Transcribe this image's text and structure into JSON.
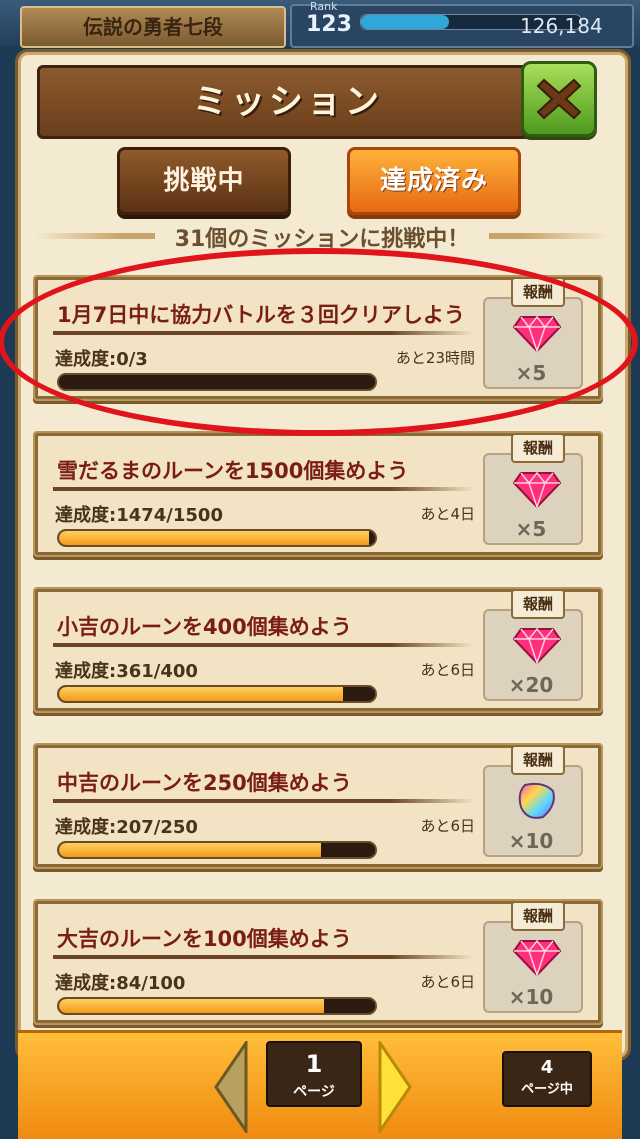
{
  "topbar": {
    "rank_title": "伝説の勇者七段",
    "rank_caption": "Rank",
    "rank_level": "123",
    "rank_points": "126,184",
    "rank_progress": 0.4
  },
  "header": {
    "title": "ミッション",
    "close_icon": "close-x-icon"
  },
  "tabs": [
    {
      "label": "挑戦中",
      "active": true
    },
    {
      "label": "達成済み",
      "active": false
    }
  ],
  "subtitle": "31個のミッションに挑戦中！",
  "reward_label": "報酬",
  "missions": [
    {
      "title": "1月7日中に協力バトルを３回クリアしよう",
      "progress": "達成度:0/3",
      "time": "あと23時間",
      "fraction": 0.0,
      "reward_icon": "gem-icon",
      "reward_count": "×5"
    },
    {
      "title": "雪だるまのルーンを1500個集めよう",
      "progress": "達成度:1474/1500",
      "time": "あと4日",
      "fraction": 0.983,
      "reward_icon": "gem-icon",
      "reward_count": "×5"
    },
    {
      "title": "小吉のルーンを400個集めよう",
      "progress": "達成度:361/400",
      "time": "あと6日",
      "fraction": 0.9025,
      "reward_icon": "gem-icon",
      "reward_count": "×20"
    },
    {
      "title": "中吉のルーンを250個集めよう",
      "progress": "達成度:207/250",
      "time": "あと6日",
      "fraction": 0.828,
      "reward_icon": "rainbow-rune-icon",
      "reward_count": "×10"
    },
    {
      "title": "大吉のルーンを100個集めよう",
      "progress": "達成度:84/100",
      "time": "あと6日",
      "fraction": 0.84,
      "reward_icon": "gem-icon",
      "reward_count": "×10"
    }
  ],
  "pagination": {
    "current": "1",
    "unit": "ページ",
    "total": "4",
    "total_unit": "ページ中"
  },
  "colors": {
    "accent_red": "#e0141a",
    "gem_pink": "#ff2f7a",
    "bar_fill": "#f39a1a"
  }
}
